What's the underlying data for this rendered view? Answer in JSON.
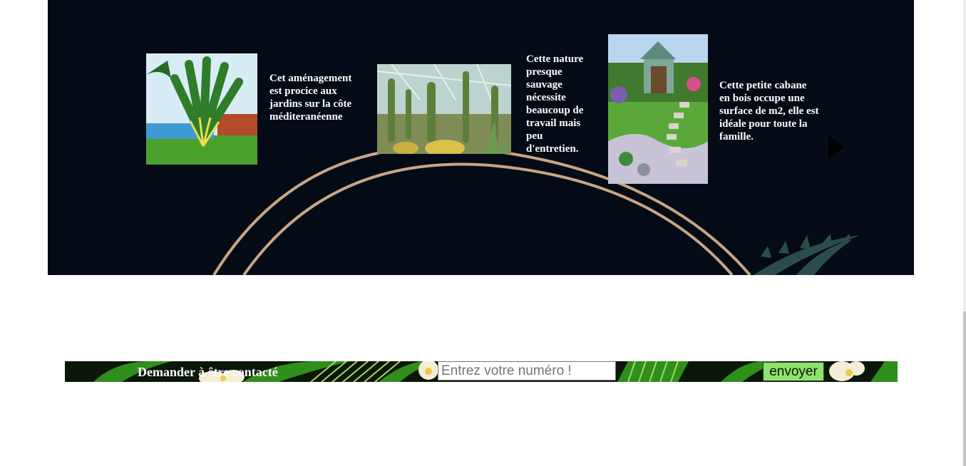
{
  "showcase": {
    "items": [
      {
        "image": "traveler-palm-garden-photo",
        "caption": "Cet aménagement est procice aux jardins sur la côte méditeranéenne"
      },
      {
        "image": "cactus-greenhouse-photo",
        "caption": "Cette nature presque sauvage nécessite beaucoup de travail mais peu d'entretien."
      },
      {
        "image": "wooden-garden-cabin-photo",
        "caption": "Cette petite cabane en bois occupe une surface de m2, elle est idéale pour toute la famille."
      }
    ],
    "next_icon": "arrow-right-icon"
  },
  "contact": {
    "label": "Demander à être contacté",
    "phone_placeholder": "Entrez votre numéro !",
    "send_label": "envoyer"
  },
  "colors": {
    "showcase_bg": "#040b16",
    "button_bg": "#8fe36b"
  }
}
